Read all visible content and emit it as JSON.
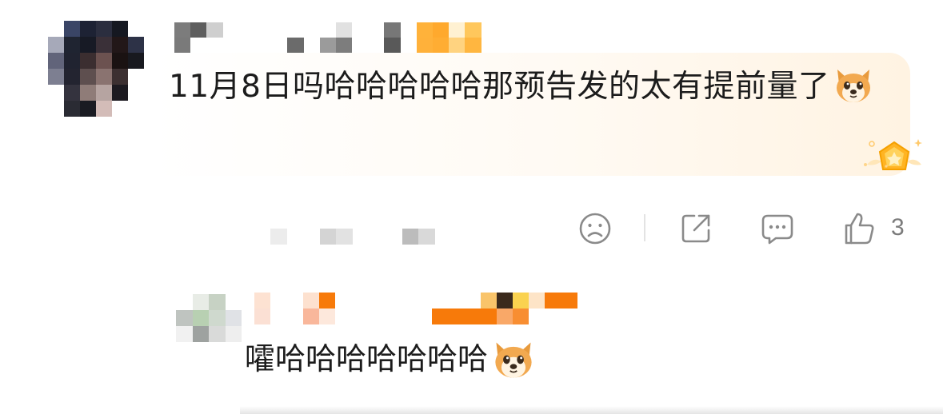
{
  "comment": {
    "text": "11月8日吗哈哈哈哈哈那预告发的太有提前量了",
    "emoji": "dog-face-emoji"
  },
  "actions": {
    "like_count": "3",
    "icons": [
      "frown-icon",
      "share-icon",
      "comment-icon",
      "thumbs-up-icon"
    ]
  },
  "reply": {
    "text": "嚯哈哈哈哈哈哈哈",
    "emoji": "dog-face-emoji"
  },
  "colors": {
    "accent_orange": "#f77a0a",
    "bubble_tint": "#fff3e2",
    "icon_gray": "#8a8a8a",
    "text": "#1c1c1c"
  }
}
